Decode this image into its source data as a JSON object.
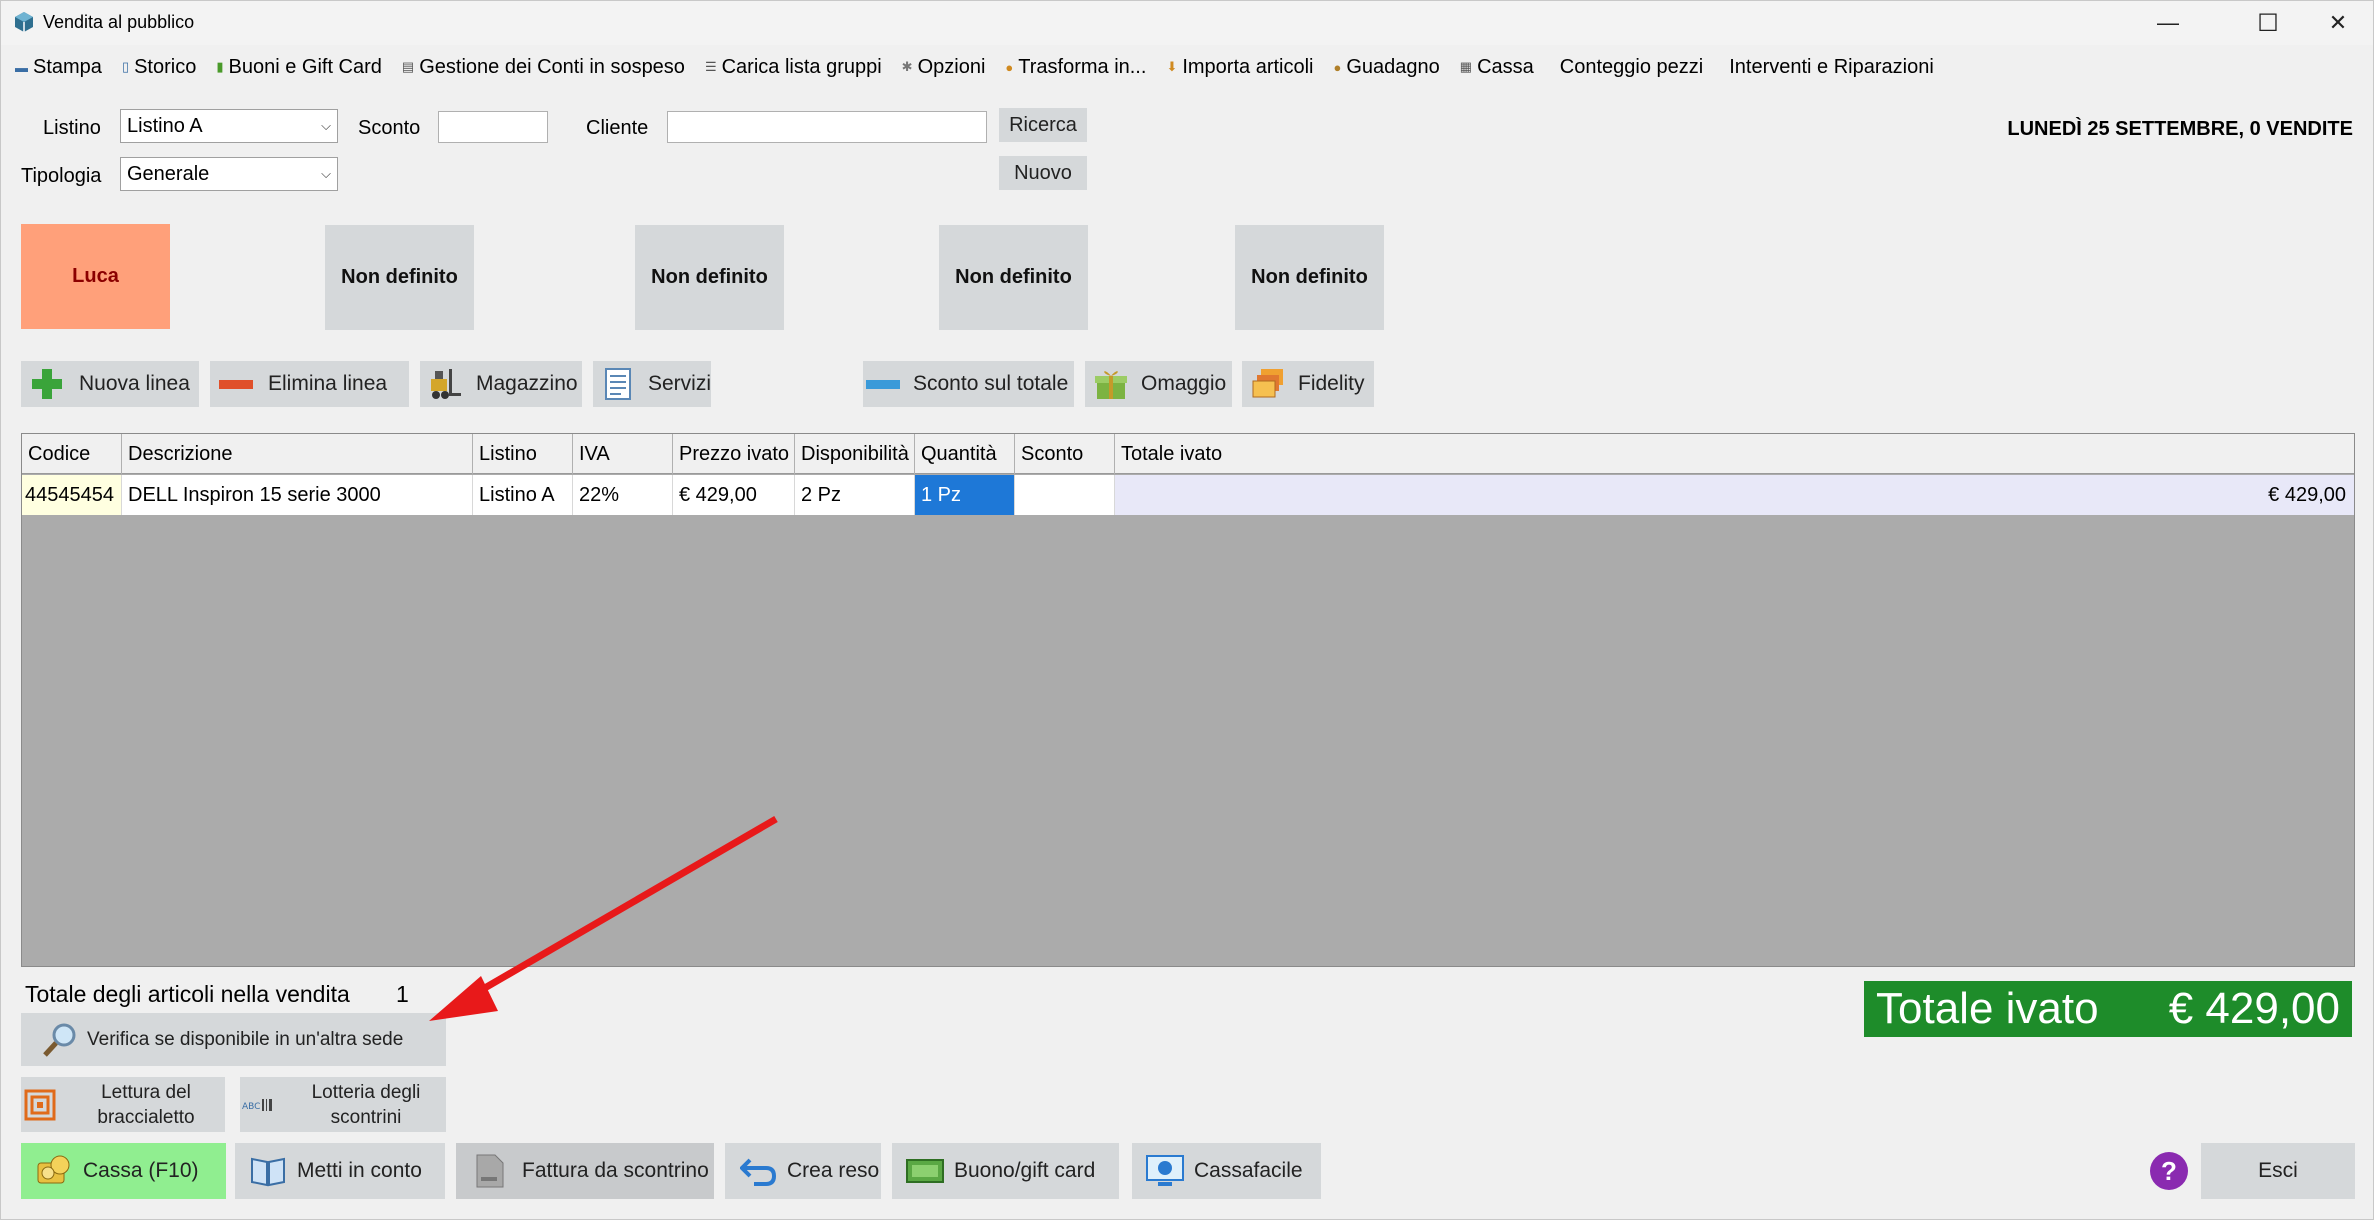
{
  "window": {
    "title": "Vendita al pubblico",
    "minimize": "—",
    "maximize": "☐",
    "close": "✕"
  },
  "menu": [
    {
      "label": "Stampa",
      "icon": "printer-icon"
    },
    {
      "label": "Storico",
      "icon": "document-icon"
    },
    {
      "label": "Buoni e Gift Card",
      "icon": "gift-icon"
    },
    {
      "label": "Gestione dei Conti in sospeso",
      "icon": "ledger-icon"
    },
    {
      "label": "Carica lista gruppi",
      "icon": "list-icon"
    },
    {
      "label": "Opzioni",
      "icon": "tools-icon"
    },
    {
      "label": "Trasforma in...",
      "icon": "transform-icon"
    },
    {
      "label": "Importa articoli",
      "icon": "import-icon"
    },
    {
      "label": "Guadagno",
      "icon": "money-bag-icon"
    },
    {
      "label": "Cassa",
      "icon": "register-icon"
    },
    {
      "label": "Conteggio pezzi",
      "icon": ""
    },
    {
      "label": "Interventi e Riparazioni",
      "icon": ""
    }
  ],
  "form": {
    "listino_label": "Listino",
    "listino_value": "Listino A",
    "sconto_label": "Sconto",
    "sconto_value": "",
    "cliente_label": "Cliente",
    "cliente_value": "",
    "ricerca_button": "Ricerca",
    "nuovo_button": "Nuovo",
    "tipologia_label": "Tipologia",
    "tipologia_value": "Generale",
    "date_status": "LUNEDÌ 25 SETTEMBRE, 0 VENDITE"
  },
  "operators": [
    "Luca",
    "Non definito",
    "Non definito",
    "Non definito",
    "Non definito"
  ],
  "toolbar": {
    "nuova_linea": "Nuova linea",
    "elimina_linea": "Elimina linea",
    "magazzino": "Magazzino",
    "servizi": "Servizi",
    "sconto_totale": "Sconto sul totale",
    "omaggio": "Omaggio",
    "fidelity": "Fidelity"
  },
  "table": {
    "headers": [
      "Codice",
      "Descrizione",
      "Listino",
      "IVA",
      "Prezzo ivato",
      "Disponibilità",
      "Quantità",
      "Sconto",
      "Totale ivato"
    ],
    "rows": [
      [
        "44545454",
        "DELL Inspiron 15 serie 3000",
        "Listino A",
        "22%",
        "€ 429,00",
        "2 Pz",
        "1 Pz",
        "",
        "€ 429,00"
      ]
    ]
  },
  "summary": {
    "count_label": "Totale degli articoli nella vendita",
    "count_value": "1",
    "total_label": "Totale ivato",
    "total_value": "€ 429,00"
  },
  "actions": {
    "verifica": "Verifica se disponibile in un'altra sede",
    "bracciale": "Lettura del braccialetto",
    "lotteria": "Lotteria degli scontrini",
    "cassa": "Cassa (F10)",
    "metti_conto": "Metti in conto",
    "fattura": "Fattura da scontrino",
    "crea_reso": "Crea reso",
    "buono": "Buono/gift card",
    "cassafacile": "Cassafacile",
    "help": "?",
    "esci": "Esci"
  },
  "colors": {
    "operator_active": "#ffa07a",
    "total_bg": "#1e8c2a",
    "cassa_bg": "#90ee90",
    "selected_cell": "#1e78d7",
    "annotation_arrow": "#e8191a"
  }
}
